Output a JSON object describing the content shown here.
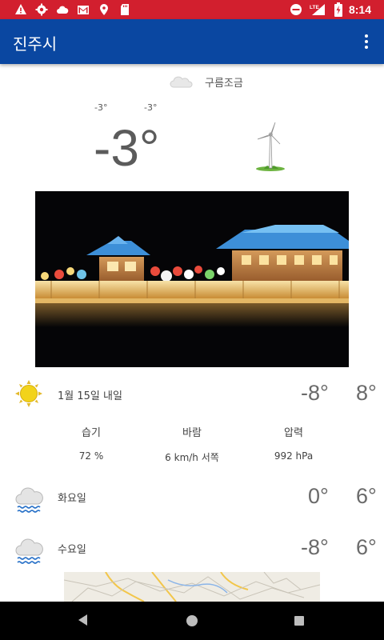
{
  "status_bar": {
    "time": "8:14",
    "network_label": "LTE",
    "left_icons": [
      "warning-icon",
      "settings-icon",
      "cloud-icon",
      "gmail-icon",
      "location-icon",
      "sd-card-icon"
    ],
    "right_icons": [
      "do-not-disturb-icon",
      "lte-signal-icon",
      "battery-charging-icon"
    ]
  },
  "toolbar": {
    "title": "진주시",
    "menu_icon": "overflow-menu-icon"
  },
  "current": {
    "condition": "구름조금",
    "min": "-3°",
    "max": "-3°",
    "temperature": "-3°",
    "condition_icon": "partly-cloudy-icon",
    "wind_icon": "wind-turbine-icon"
  },
  "tomorrow": {
    "label": "1월 15일 내일",
    "low": "-8°",
    "high": "8°",
    "icon": "sun-icon"
  },
  "details": {
    "humidity_label": "습기",
    "humidity_value": "72 %",
    "wind_label": "바람",
    "wind_value": "6 km/h 서쪽",
    "pressure_label": "압력",
    "pressure_value": "992 hPa"
  },
  "forecast": [
    {
      "day": "화요일",
      "low": "0°",
      "high": "6°",
      "icon": "rain-cloud-icon"
    },
    {
      "day": "수요일",
      "low": "-8°",
      "high": "6°",
      "icon": "rain-cloud-icon"
    }
  ],
  "colors": {
    "status_bar": "#d21f2e",
    "toolbar": "#0a47a1",
    "sun": "#f2d31a",
    "rain": "#2a72c8"
  }
}
